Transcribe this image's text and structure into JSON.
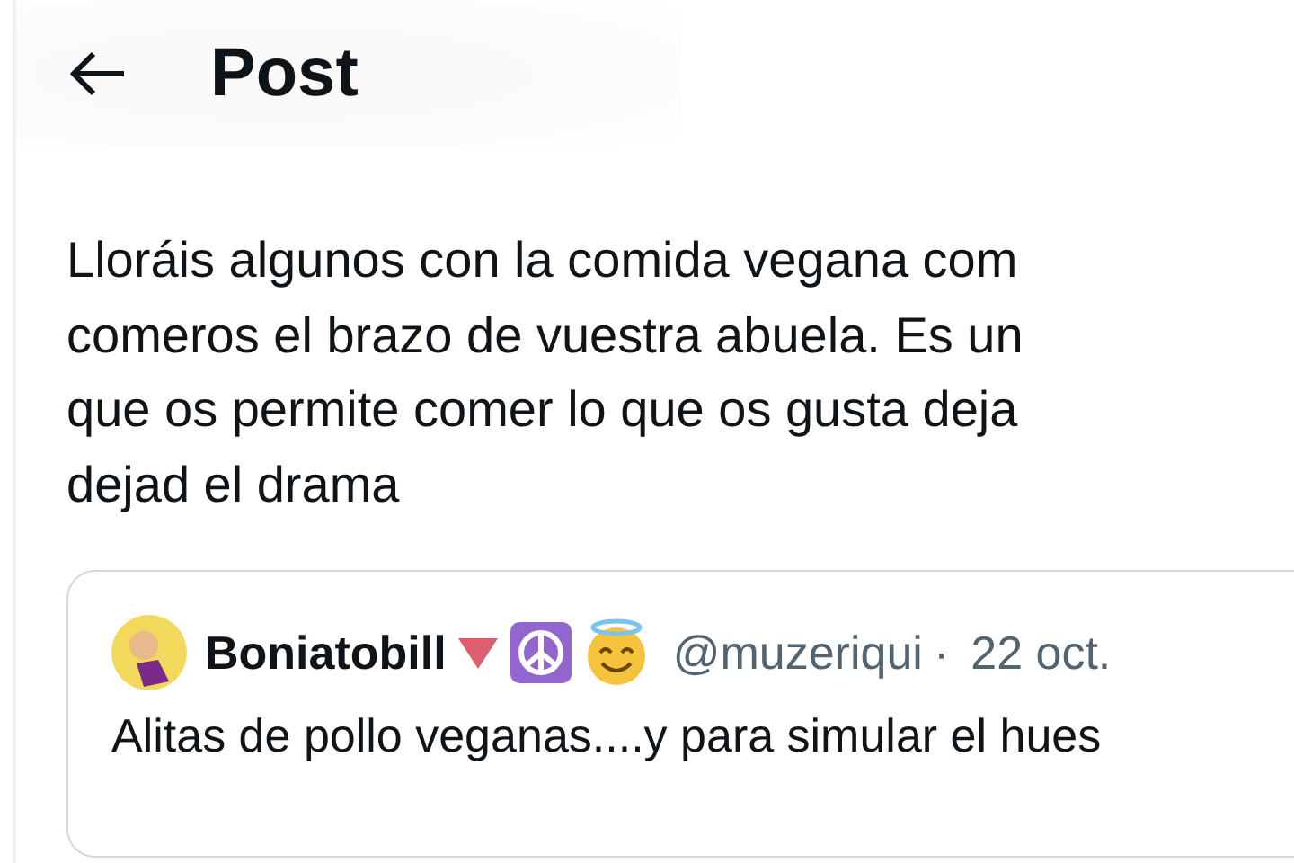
{
  "header": {
    "title": "Post"
  },
  "post": {
    "lines": [
      "Lloráis algunos con la comida vegana com",
      "comeros el brazo de vuestra abuela. Es un",
      "que os permite comer lo que os gusta deja",
      "dejad el drama"
    ]
  },
  "quoted_post": {
    "author": "Boniatobill",
    "handle": "@muzeriqui",
    "separator": "·",
    "date": "22 oct.",
    "text": "Alitas de pollo veganas....y para simular el hues"
  }
}
